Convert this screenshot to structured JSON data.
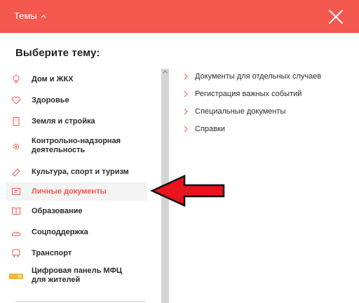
{
  "header": {
    "title": "Темы",
    "background": "#f4584f"
  },
  "choose_title": "Выберите тему:",
  "topics": [
    {
      "label": "Дом и ЖКХ",
      "icon": "lightbulb-icon",
      "active": false
    },
    {
      "label": "Здоровье",
      "icon": "heart-icon",
      "active": false
    },
    {
      "label": "Земля и стройка",
      "icon": "building-icon",
      "active": false
    },
    {
      "label": "Контрольно-надзорная деятельность",
      "icon": "gear-icon",
      "active": false
    },
    {
      "label": "Культура, спорт и туризм",
      "icon": "ticket-icon",
      "active": false
    },
    {
      "label": "Личные документы",
      "icon": "id-card-icon",
      "active": true
    },
    {
      "label": "Образование",
      "icon": "book-icon",
      "active": false
    },
    {
      "label": "Соцподдержка",
      "icon": "hands-icon",
      "active": false
    },
    {
      "label": "Транспорт",
      "icon": "car-icon",
      "active": false
    },
    {
      "label": "Цифровая панель МФЦ для жителей",
      "icon": "card-icon",
      "active": false
    }
  ],
  "subtopics": [
    "Документы для отдельных случаев",
    "Регистрация важных событий",
    "Специальные документы",
    "Справки"
  ],
  "colors": {
    "accent": "#f4584f",
    "arrow": "#e8141e",
    "active_bg": "#f3f3f3"
  }
}
